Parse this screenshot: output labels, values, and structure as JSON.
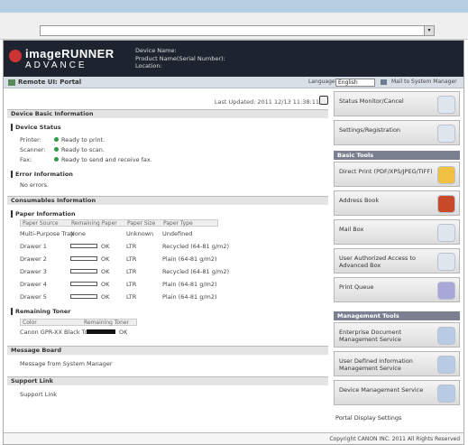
{
  "browser": {
    "dropdown_glyph": "▾"
  },
  "header": {
    "brand_line1": "imageRUNNER",
    "brand_line2": "ADVANCE",
    "device_name_label": "Device Name:",
    "product_name_label": "Product Name(Serial Number):",
    "location_label": "Location:",
    "subtitle": "Remote UI: Portal",
    "language_label": "Language:",
    "language_value": "English",
    "mail_label": "Mail to System Manager"
  },
  "main": {
    "last_updated": "Last Updated: 2011 12/13 11:38:11",
    "device_basic_info": "Device Basic Information",
    "device_status": "Device Status",
    "printer_label": "Printer:",
    "printer_value": "Ready to print.",
    "scanner_label": "Scanner:",
    "scanner_value": "Ready to scan.",
    "fax_label": "Fax:",
    "fax_value": "Ready to send and receive fax.",
    "error_info": "Error Information",
    "error_none": "No errors.",
    "consumables": "Consumables Information",
    "paper_info": "Paper Information",
    "paper_headers": [
      "Paper Source",
      "Remaining Paper",
      "Paper Size",
      "Paper Type"
    ],
    "paper_rows": [
      {
        "source": "Multi-Purpose Tray",
        "remaining": "None",
        "size": "Unknown",
        "type": "Undefined"
      },
      {
        "source": "Drawer 1",
        "remaining": "OK",
        "size": "LTR",
        "type": "Recycled (64-81 g/m2)"
      },
      {
        "source": "Drawer 2",
        "remaining": "OK",
        "size": "LTR",
        "type": "Plain (64-81 g/m2)"
      },
      {
        "source": "Drawer 3",
        "remaining": "OK",
        "size": "LTR",
        "type": "Recycled (64-81 g/m2)"
      },
      {
        "source": "Drawer 4",
        "remaining": "OK",
        "size": "LTR",
        "type": "Plain (64-81 g/m2)"
      },
      {
        "source": "Drawer 5",
        "remaining": "OK",
        "size": "LTR",
        "type": "Plain (64-81 g/m2)"
      }
    ],
    "remaining_toner": "Remaining Toner",
    "toner_headers": [
      "Color",
      "Remaining Toner"
    ],
    "toner_color": "Canon GPR-XX Black Toner",
    "toner_remaining": "OK",
    "message_board": "Message Board",
    "message_text": "Message from System Manager",
    "support_link": "Support Link",
    "support_text": "Support Link"
  },
  "side": {
    "status_monitor": "Status Monitor/Cancel",
    "settings": "Settings/Registration",
    "basic_tools": "Basic Tools",
    "direct_print": "Direct Print (PDF/XPS/JPEG/TIFF)",
    "address_book": "Address Book",
    "mail_box": "Mail Box",
    "advanced_space": "User Authorized Access to Advanced Box",
    "print_queue": "Print Queue",
    "management_tools": "Management Tools",
    "mgmt1": "Enterprise Document Management Service",
    "mgmt2": "User Defined Information Management Service",
    "mgmt3": "Device Management Service",
    "portal": "Portal Display Settings"
  },
  "footer": {
    "copyright": "Copyright CANON INC. 2011 All Rights Reserved"
  }
}
